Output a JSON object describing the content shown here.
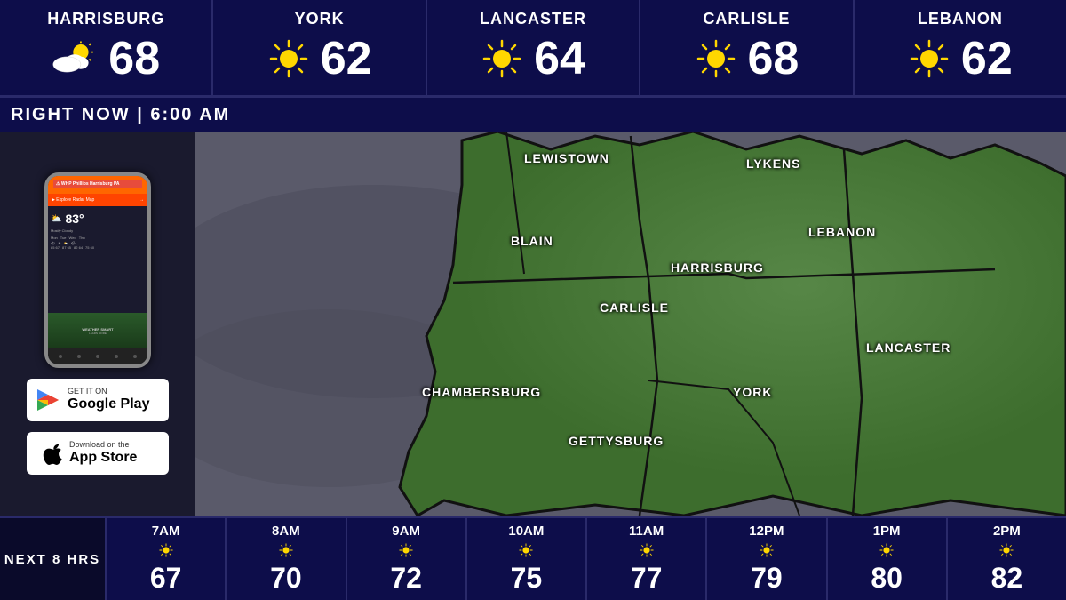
{
  "topBar": {
    "cities": [
      {
        "name": "HARRISBURG",
        "temp": "68",
        "icon": "cloud-sun"
      },
      {
        "name": "YORK",
        "temp": "62",
        "icon": "sun"
      },
      {
        "name": "LANCASTER",
        "temp": "64",
        "icon": "sun"
      },
      {
        "name": "CARLISLE",
        "temp": "68",
        "icon": "sun"
      },
      {
        "name": "LEBANON",
        "temp": "62",
        "icon": "sun"
      }
    ]
  },
  "rightNow": {
    "label": "RIGHT NOW | 6:00 AM"
  },
  "map": {
    "labels": [
      {
        "name": "LEWISTOWN",
        "left": "385",
        "top": "28"
      },
      {
        "name": "LYKENS",
        "left": "620",
        "top": "38"
      },
      {
        "name": "BLAIN",
        "left": "370",
        "top": "120"
      },
      {
        "name": "HARRISBURG",
        "left": "555",
        "top": "148"
      },
      {
        "name": "LEBANON",
        "left": "690",
        "top": "115"
      },
      {
        "name": "CARLISLE",
        "left": "465",
        "top": "198"
      },
      {
        "name": "CHAMBERSBURG",
        "left": "275",
        "top": "290"
      },
      {
        "name": "GETTYSBURG",
        "left": "440",
        "top": "345"
      },
      {
        "name": "YORK",
        "left": "620",
        "top": "295"
      },
      {
        "name": "LANCASTER",
        "left": "760",
        "top": "240"
      }
    ]
  },
  "phone": {
    "header": "WHP Phillips Harrisburg PA",
    "nav": "Explore Radar Map",
    "temp": "83°",
    "label": "WEATHER SMART"
  },
  "appStore": {
    "googlePlay": {
      "topText": "GET IT ON",
      "name": "Google Play"
    },
    "appStore": {
      "topText": "Download on the",
      "name": "App Store"
    }
  },
  "bottomBar": {
    "nextLabel": "NEXT 8 HRS",
    "forecasts": [
      {
        "time": "7AM",
        "temp": "67",
        "icon": "sun"
      },
      {
        "time": "8AM",
        "temp": "70",
        "icon": "sun"
      },
      {
        "time": "9AM",
        "temp": "72",
        "icon": "sun"
      },
      {
        "time": "10AM",
        "temp": "75",
        "icon": "sun"
      },
      {
        "time": "11AM",
        "temp": "77",
        "icon": "sun"
      },
      {
        "time": "12PM",
        "temp": "79",
        "icon": "sun"
      },
      {
        "time": "1PM",
        "temp": "80",
        "icon": "sun"
      },
      {
        "time": "2PM",
        "temp": "82",
        "icon": "sun"
      }
    ]
  }
}
